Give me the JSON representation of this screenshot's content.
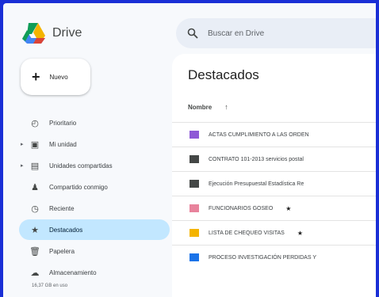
{
  "app": {
    "name": "Drive"
  },
  "search": {
    "placeholder": "Buscar en Drive"
  },
  "sidebar": {
    "new_label": "Nuevo",
    "items": [
      {
        "label": "Prioritario",
        "icon": "clock-check-icon",
        "expandable": false,
        "active": false
      },
      {
        "label": "Mi unidad",
        "icon": "drive-icon",
        "expandable": true,
        "active": false
      },
      {
        "label": "Unidades compartidas",
        "icon": "shared-drives-icon",
        "expandable": true,
        "active": false
      },
      {
        "label": "Compartido conmigo",
        "icon": "people-icon",
        "expandable": false,
        "active": false
      },
      {
        "label": "Reciente",
        "icon": "clock-icon",
        "expandable": false,
        "active": false
      },
      {
        "label": "Destacados",
        "icon": "star-icon",
        "expandable": false,
        "active": true
      },
      {
        "label": "Papelera",
        "icon": "trash-icon",
        "expandable": false,
        "active": false
      },
      {
        "label": "Almacenamiento",
        "icon": "cloud-icon",
        "expandable": false,
        "active": false
      }
    ],
    "storage_text": "16,37 GB en uso"
  },
  "main": {
    "title": "Destacados",
    "sort_label": "Nombre",
    "sort_arrow": "↑",
    "files": [
      {
        "name": "ACTAS CUMPLIMIENTO A LAS ORDEN",
        "color": "#8e59d6",
        "starred": false
      },
      {
        "name": "CONTRATO 101-2013 servicios postal",
        "color": "#444746",
        "starred": false
      },
      {
        "name": "Ejecución Presupuestal Estadística Re",
        "color": "#444746",
        "starred": false
      },
      {
        "name": "FUNCIONARIOS GOSEO",
        "color": "#e8839c",
        "starred": true
      },
      {
        "name": "LISTA DE CHEQUEO VISITAS",
        "color": "#f4b400",
        "starred": true
      },
      {
        "name": "PROCESO INVESTIGACIÓN PERDIDAS Y",
        "color": "#1a73e8",
        "starred": false
      }
    ],
    "star_glyph": "★"
  },
  "colors": {
    "frame": "#1a2fd6",
    "active_nav": "#c2e7ff",
    "search_bg": "#e9eef6"
  }
}
